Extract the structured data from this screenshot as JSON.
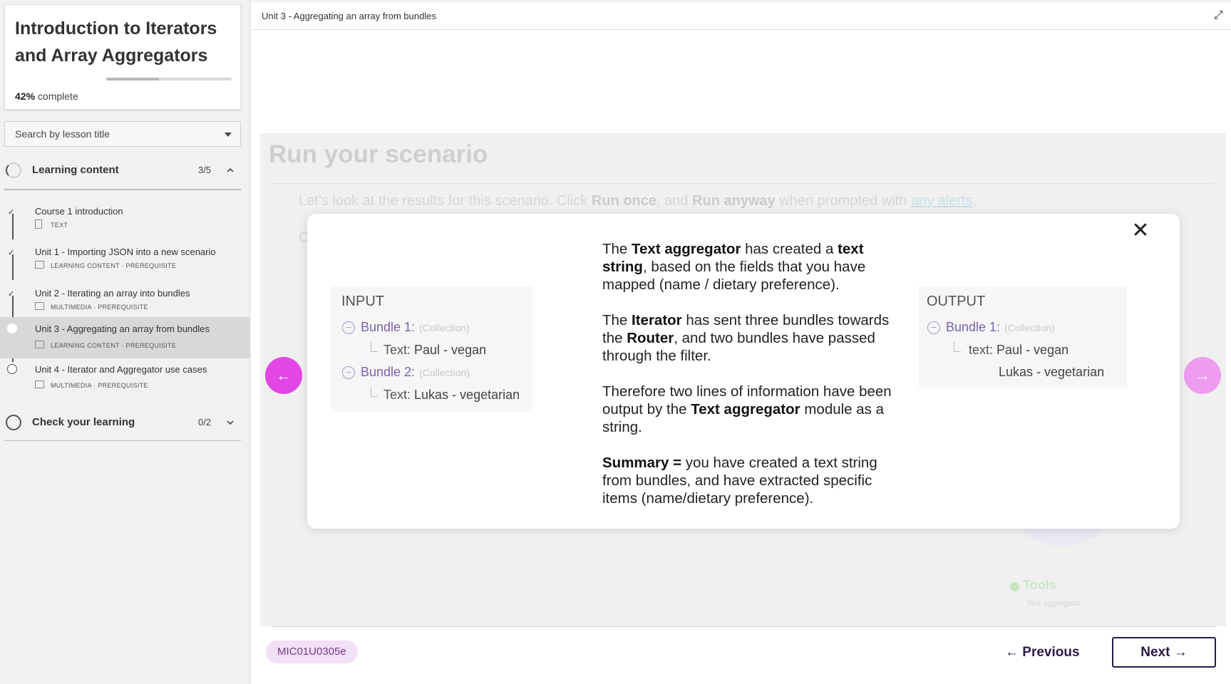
{
  "course": {
    "title": "Introduction to Iterators and Array Aggregators",
    "progress_percent": 42,
    "progress_pct_text": "42%",
    "progress_suffix": "complete"
  },
  "search": {
    "placeholder": "Search by lesson title"
  },
  "sections": [
    {
      "label": "Learning content",
      "count": "3/5",
      "expanded": true
    },
    {
      "label": "Check your learning",
      "count": "0/2",
      "expanded": false
    }
  ],
  "lessons": [
    {
      "title": "Course 1 introduction",
      "meta": "TEXT",
      "status": "done"
    },
    {
      "title": "Unit 1 - Importing JSON into a new scenario",
      "meta": "LEARNING CONTENT · PREREQUISITE",
      "status": "done"
    },
    {
      "title": "Unit 2 - Iterating an array into bundles",
      "meta": "MULTIMEDIA · PREREQUISITE",
      "status": "done"
    },
    {
      "title": "Unit 3 - Aggregating an array from bundles",
      "meta": "LEARNING CONTENT · PREREQUISITE",
      "status": "active"
    },
    {
      "title": "Unit 4 - Iterator and Aggregator use cases",
      "meta": "MULTIMEDIA · PREREQUISITE",
      "status": "todo"
    }
  ],
  "topbar": {
    "breadcrumb": "Unit 3 - Aggregating an array from bundles"
  },
  "lesson_bg": {
    "title": "Run your scenario",
    "line_a": "Let’s look at the results for this scenario. Click ",
    "run_once": "Run once",
    "line_b": ", and ",
    "run_anyway": "Run anyway",
    "line_c": " when prompted with ",
    "any_alerts": "any alerts",
    "line_d": ".",
    "c_letter": "C",
    "tools": "Tools",
    "tools_sub": "Text aggregator"
  },
  "modal": {
    "input": {
      "title": "INPUT",
      "bundle1": "Bundle 1:",
      "bundle2": "Bundle 2:",
      "collection": "(Collection)",
      "text_key": "Text:",
      "value1": "Paul - vegan",
      "value2": "Lukas - vegetarian"
    },
    "output": {
      "title": "OUTPUT",
      "bundle1": "Bundle 1:",
      "collection": "(Collection)",
      "text_key": "text:",
      "value_line1": "Paul - vegan",
      "value_line2": "Lukas - vegetarian"
    },
    "p1": {
      "a": "The ",
      "b": "Text aggregator",
      "c": " has created a ",
      "d": "text string",
      "e": ", based on the fields that you have mapped (name / dietary preference)."
    },
    "p2": {
      "a": "The ",
      "b": "Iterator",
      "c": " has sent three bundles towards the ",
      "d": "Router",
      "e": ", and two bundles have passed through the filter."
    },
    "p3": {
      "a": "Therefore two lines of information have been output by the ",
      "b": "Text aggregator",
      "c": " module as a string."
    },
    "p4": {
      "a": "Summary =",
      "b": " you have created a text string from bundles, and have extracted specific items (name/dietary preference)."
    }
  },
  "footer": {
    "code": "MIC01U0305e",
    "previous": "Previous",
    "next": "Next"
  },
  "colors": {
    "accent": "#e247e6",
    "accent_light": "#ee9cf0",
    "primary_dark": "#2b1a4a",
    "badge_bg": "#f1e0f6"
  }
}
